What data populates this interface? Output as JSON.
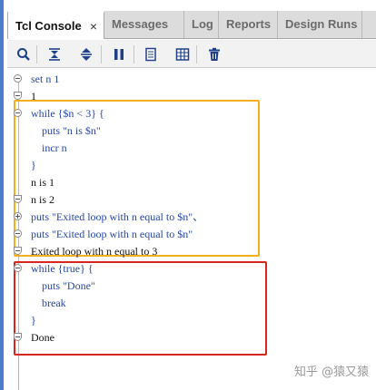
{
  "tabs": [
    {
      "label": "Tcl Console",
      "active": true
    },
    {
      "label": "Messages"
    },
    {
      "label": "Log"
    },
    {
      "label": "Reports"
    },
    {
      "label": "Design Runs"
    }
  ],
  "tab_close_glyph": "×",
  "toolbar_icons": [
    "search-icon",
    "collapse-all-icon",
    "expand-all-icon",
    "pause-icon",
    "copy-icon",
    "columns-icon",
    "delete-icon"
  ],
  "console": {
    "lines": [
      {
        "text": "set n 1",
        "type": "command",
        "fold": "open"
      },
      {
        "text": "1",
        "type": "output",
        "fold": "end"
      },
      {
        "text": "while {$n < 3} {",
        "type": "command",
        "fold": "open"
      },
      {
        "text": "    puts \"n is $n\"",
        "type": "command"
      },
      {
        "text": "    incr n",
        "type": "command"
      },
      {
        "text": "}",
        "type": "command"
      },
      {
        "text": "n is 1",
        "type": "output"
      },
      {
        "text": "n is 2",
        "type": "output",
        "fold": "end"
      },
      {
        "text": "puts \"Exited loop with n equal to $n\"、",
        "type": "command",
        "fold": "collapsed"
      },
      {
        "text": "puts \"Exited loop with n equal to $n\"",
        "type": "command",
        "fold": "open"
      },
      {
        "text": "Exited loop with n equal to 3",
        "type": "output",
        "fold": "end"
      },
      {
        "text": "while {true} {",
        "type": "command",
        "fold": "open"
      },
      {
        "text": "    puts \"Done\"",
        "type": "command"
      },
      {
        "text": "    break",
        "type": "command"
      },
      {
        "text": "}",
        "type": "command"
      },
      {
        "text": "Done",
        "type": "output",
        "fold": "end"
      }
    ]
  },
  "watermark": "知乎 @猿又猿",
  "colors": {
    "accent_border": "#4b7cc7",
    "command_text": "#2646a9",
    "highlight_yellow": "#f2b01e",
    "highlight_red": "#d9261c"
  }
}
